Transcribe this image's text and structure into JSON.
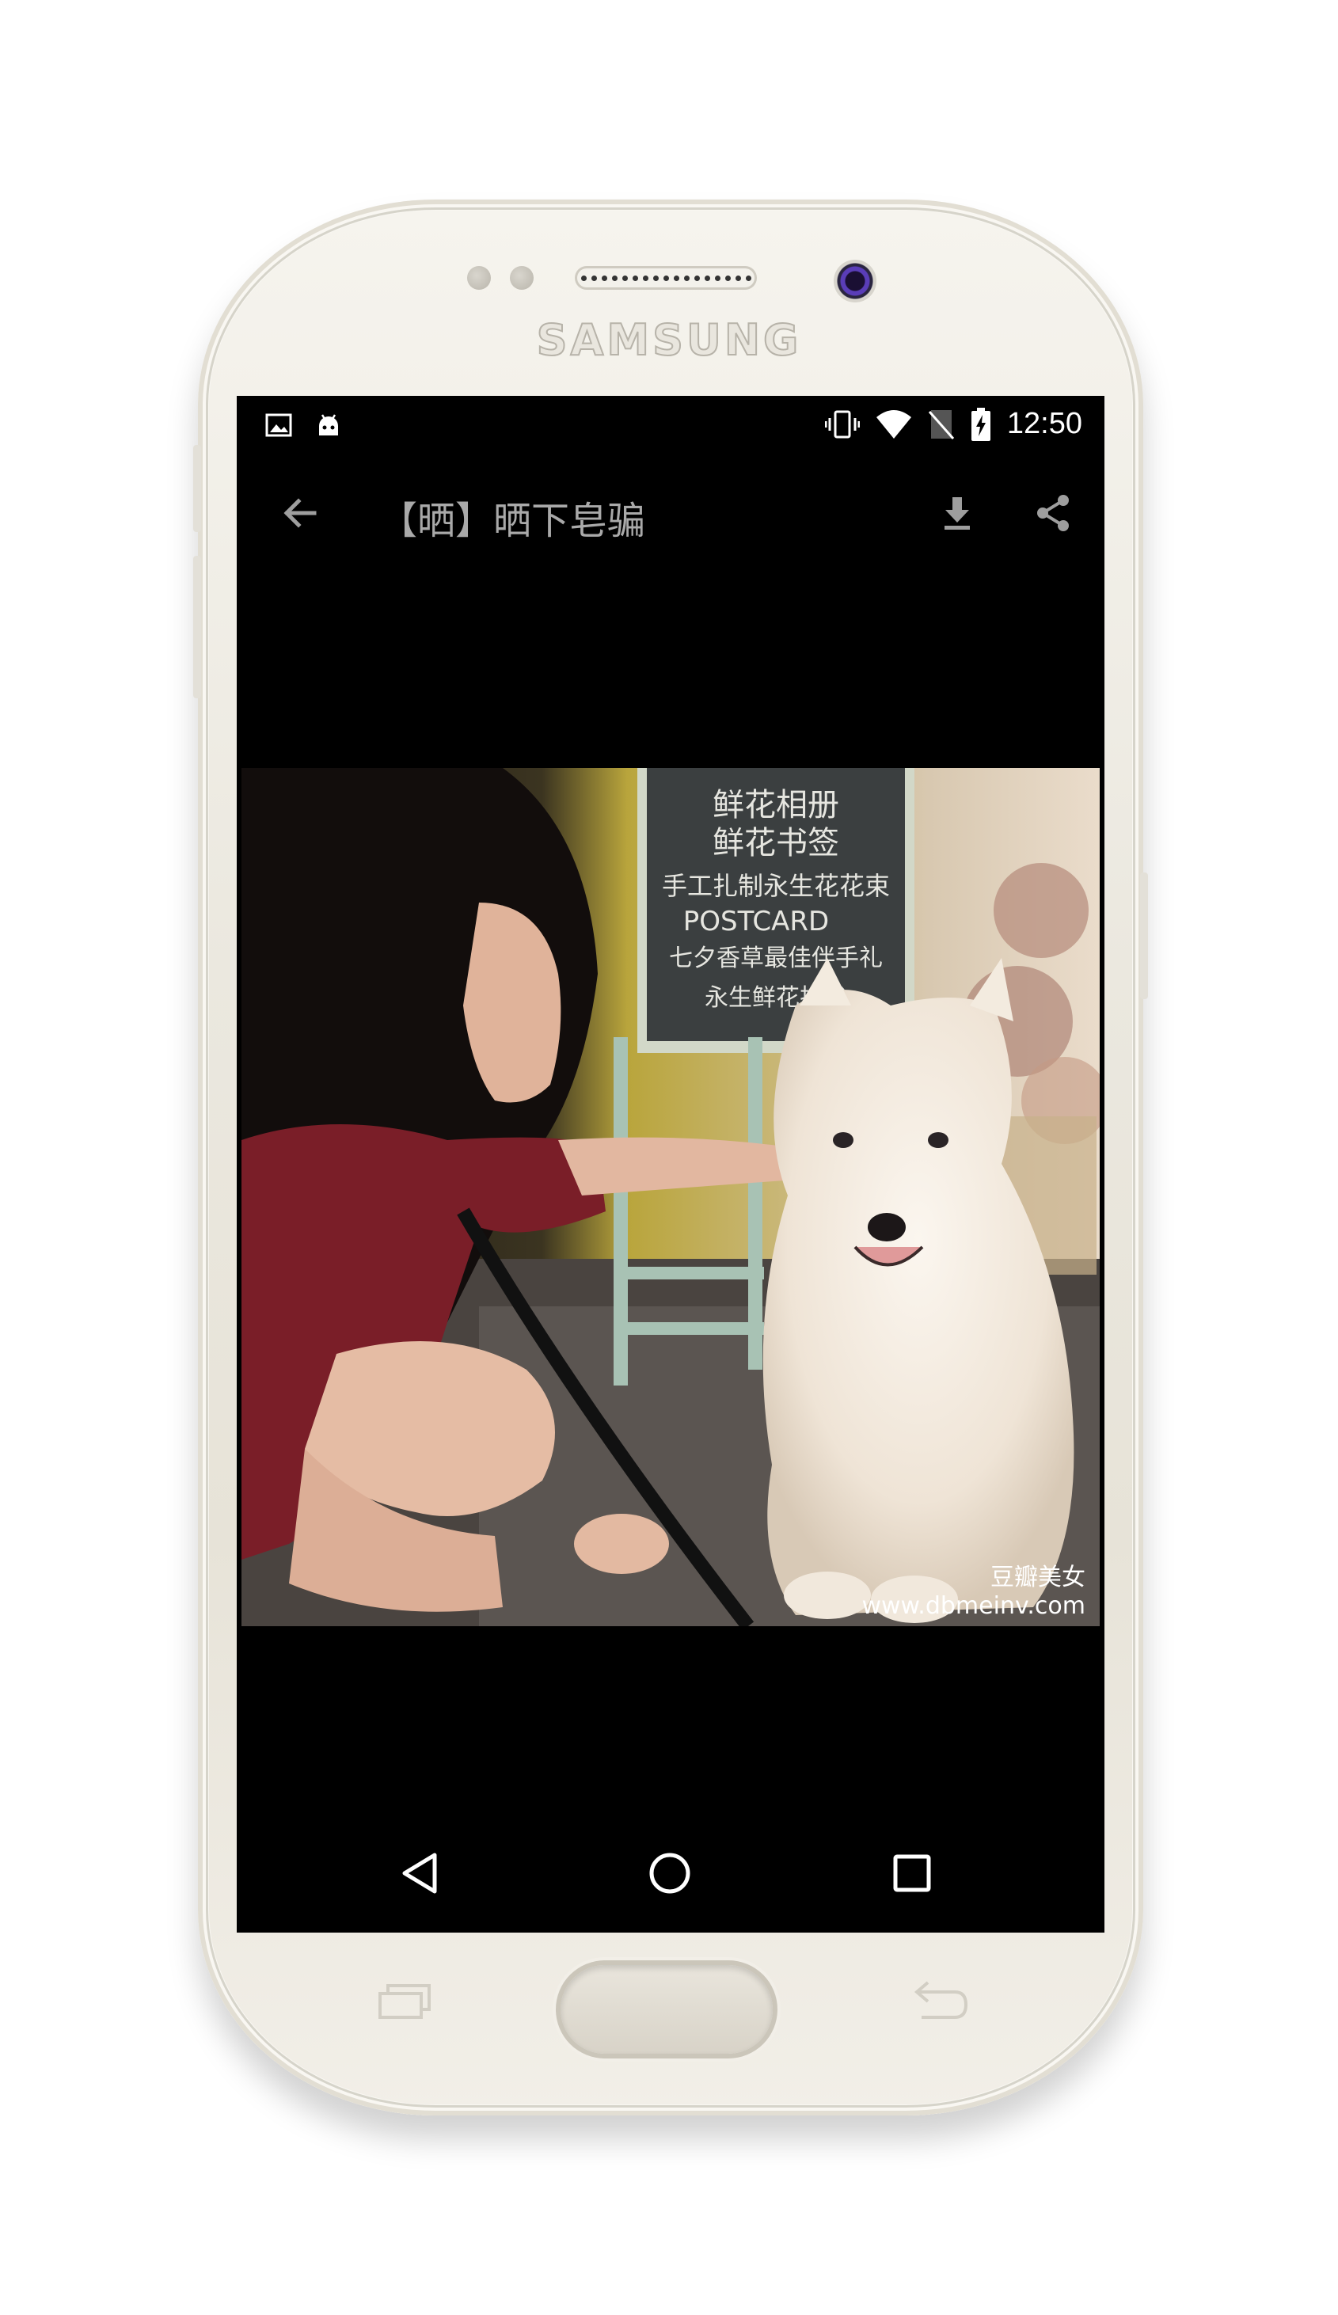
{
  "device": {
    "brand": "SAMSUNG"
  },
  "status_bar": {
    "left_icons": [
      "image-notification-icon",
      "android-notification-icon"
    ],
    "right_icons": [
      "vibrate-icon",
      "wifi-icon",
      "no-sim-icon",
      "battery-charging-icon"
    ],
    "time": "12:50"
  },
  "app_bar": {
    "title": "【晒】晒下皂骗",
    "back_icon": "arrow-back-icon",
    "actions": [
      "download-icon",
      "share-icon"
    ]
  },
  "photo": {
    "chalkboard_lines": [
      "鲜花相册",
      "鲜花书签",
      "手工扎制永生花花束",
      "POSTCARD",
      "七夕香草最佳伴手礼",
      "永生鲜花排优"
    ],
    "watermark_line1": "豆瓣美女",
    "watermark_line2": "www.dbmeinv.com"
  },
  "nav_bar": {
    "buttons": [
      "back-triangle-icon",
      "home-circle-icon",
      "recents-square-icon"
    ]
  },
  "colors": {
    "screen_bg": "#000000",
    "title_text": "#a9a9a9",
    "phone_body": "#ebe8df"
  }
}
